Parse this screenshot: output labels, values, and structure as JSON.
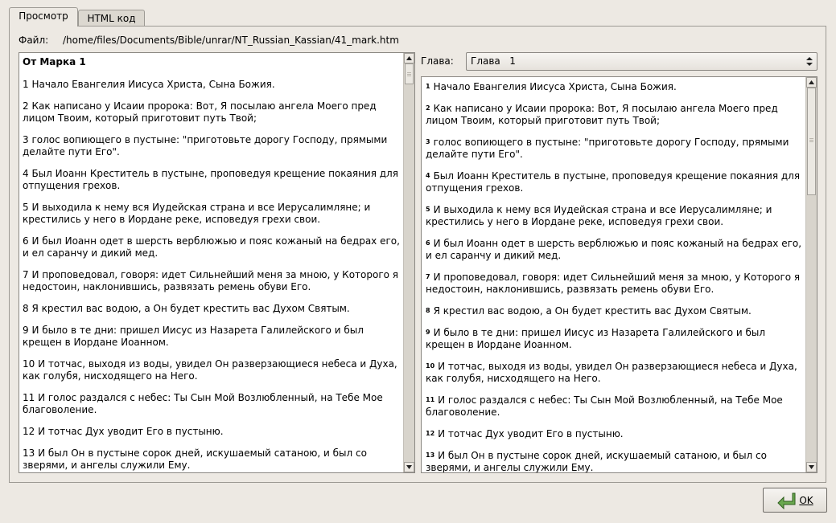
{
  "tabs": [
    {
      "label": "Просмотр",
      "active": true
    },
    {
      "label": "HTML код",
      "active": false
    }
  ],
  "file": {
    "label": "Файл:",
    "path": "/home/files/Documents/Bible/unrar/NT_Russian_Kassian/41_mark.htm"
  },
  "chapter_selector": {
    "label": "Глава:",
    "value": "Глава   1"
  },
  "left_pane": {
    "title": "От Марка 1",
    "verses": [
      "1 Начало Евангелия Иисуса Христа, Сына Божия.",
      "2 Как написано у Исаии пророка: Вот, Я посылаю ангела Моего пред лицом Твоим, который приготовит путь Твой;",
      "3 голос вопиющего в пустыне: \"приготовьте дорогу Господу, прямыми делайте пути Его\".",
      "4 Был Иоанн Креститель в пустыне, проповедуя крещение покаяния для отпущения грехов.",
      "5 И выходила к нему вся Иудейская страна и все Иерусалимляне; и крестились у него в Иордане реке, исповедуя грехи свои.",
      "6 И был Иоанн одет в шерсть верблюжью и пояс кожаный на бедрах его, и ел саранчу и дикий мед.",
      "7 И проповедовал, говоря: идет Сильнейший меня за мною, у Которого я недостоин, наклонившись, развязать ремень обуви Его.",
      "8 Я крестил вас водою, а Он будет крестить вас Духом Святым.",
      "9 И было в те дни: пришел Иисус из Назарета Галилейского и был крещен в Иордане Иоанном.",
      "10 И тотчас, выходя из воды, увидел Он разверзающиеся небеса и Духа, как голубя, нисходящего на Него.",
      "11 И голос раздался с небес: Ты Сын Мой Возлюбленный, на Тебе Мое благоволение.",
      "12 И тотчас Дух уводит Его в пустыню.",
      "13 И был Он в пустыне сорок дней, искушаемый сатаною, и был со зверями, и ангелы служили Ему."
    ]
  },
  "right_pane": {
    "verses": [
      {
        "n": "1",
        "text": "Начало Евангелия Иисуса Христа, Сына Божия."
      },
      {
        "n": "2",
        "text": "Как написано у Исаии пророка: Вот, Я посылаю ангела Моего пред лицом Твоим, который приготовит путь Твой;"
      },
      {
        "n": "3",
        "text": "голос вопиющего в пустыне: \"приготовьте дорогу Господу, прямыми делайте пути Его\"."
      },
      {
        "n": "4",
        "text": "Был Иоанн Креститель в пустыне, проповедуя крещение покаяния для отпущения грехов."
      },
      {
        "n": "5",
        "text": "И выходила к нему вся Иудейская страна и все Иерусалимляне; и крестились у него в Иордане реке, исповедуя грехи свои."
      },
      {
        "n": "6",
        "text": "И был Иоанн одет в шерсть верблюжью и пояс кожаный на бедрах его, и ел саранчу и дикий мед."
      },
      {
        "n": "7",
        "text": "И проповедовал, говоря: идет Сильнейший меня за мною, у Которого я недостоин, наклонившись, развязать ремень обуви Его."
      },
      {
        "n": "8",
        "text": "Я крестил вас водою, а Он будет крестить вас Духом Святым."
      },
      {
        "n": "9",
        "text": "И было в те дни: пришел Иисус из Назарета Галилейского и был крещен в Иордане Иоанном."
      },
      {
        "n": "10",
        "text": "И тотчас, выходя из воды, увидел Он разверзающиеся небеса и Духа, как голубя, нисходящего на Него."
      },
      {
        "n": "11",
        "text": "И голос раздался с небес: Ты Сын Мой Возлюбленный, на Тебе Мое благоволение."
      },
      {
        "n": "12",
        "text": "И тотчас Дух уводит Его в пустыню."
      },
      {
        "n": "13",
        "text": "И был Он в пустыне сорок дней, искушаемый сатаною, и был со зверями, и ангелы служили Ему."
      }
    ]
  },
  "buttons": {
    "ok_label": "OK"
  },
  "colors": {
    "window_bg": "#ede9e3",
    "pane_bg": "#ffffff",
    "border": "#9d9a94"
  },
  "icons": {
    "ok_icon": "return-arrow-icon",
    "scroll_up": "arrow-up-icon",
    "scroll_down": "arrow-down-icon",
    "combo": "updown-chevron-icon"
  }
}
